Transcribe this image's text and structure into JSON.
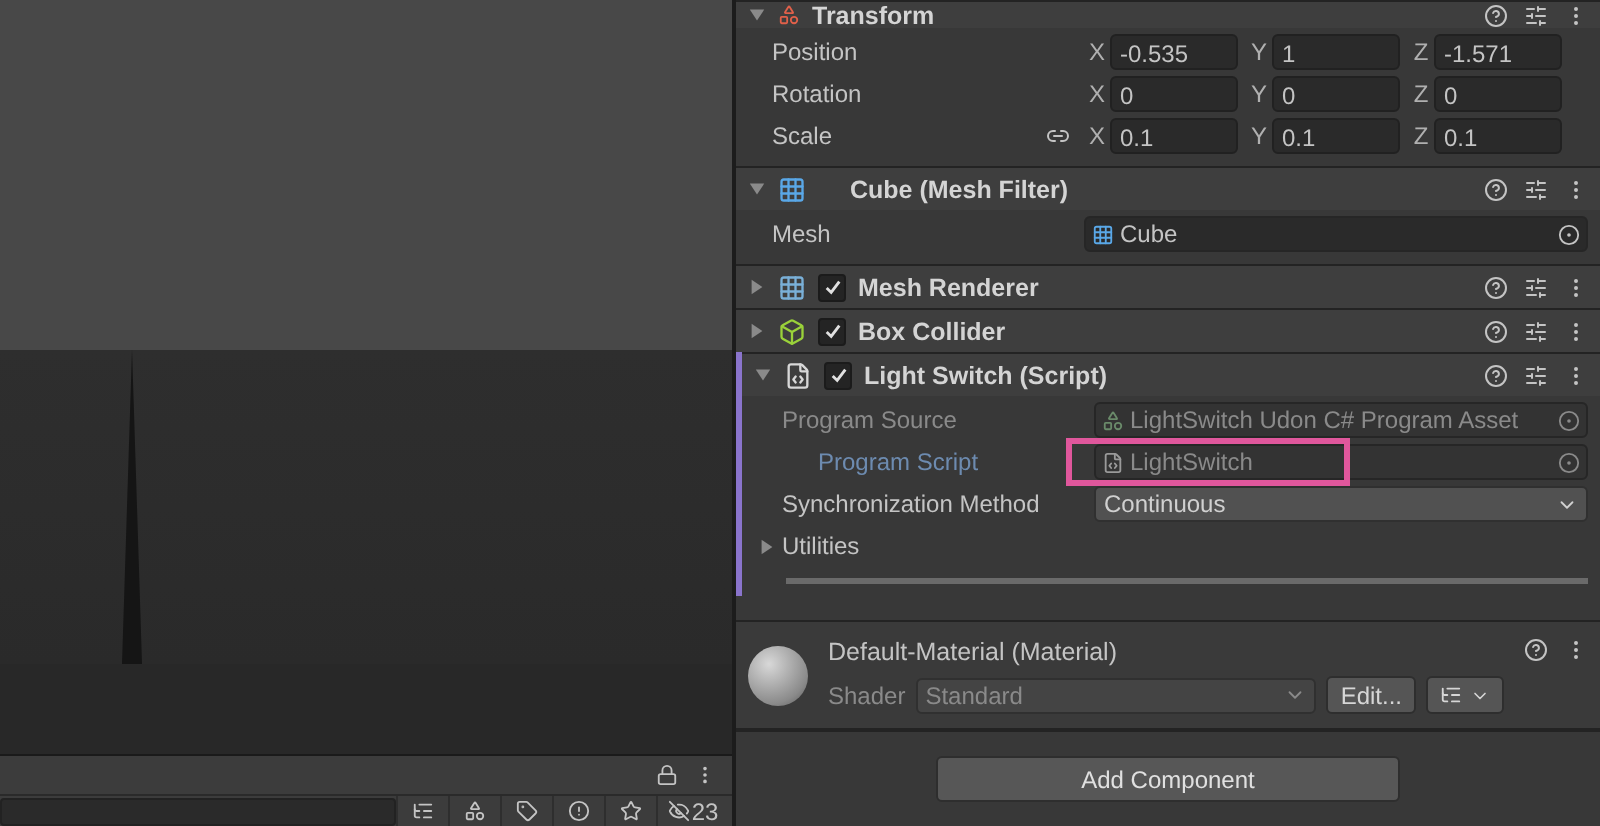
{
  "scene_toolbar": {
    "count": "23"
  },
  "transform": {
    "title": "Transform",
    "expanded": true,
    "rows": [
      {
        "label": "Position",
        "linked": false,
        "values": [
          {
            "axis": "X",
            "value": "-0.535"
          },
          {
            "axis": "Y",
            "value": "1"
          },
          {
            "axis": "Z",
            "value": "-1.571"
          }
        ]
      },
      {
        "label": "Rotation",
        "linked": false,
        "values": [
          {
            "axis": "X",
            "value": "0"
          },
          {
            "axis": "Y",
            "value": "0"
          },
          {
            "axis": "Z",
            "value": "0"
          }
        ]
      },
      {
        "label": "Scale",
        "linked": true,
        "values": [
          {
            "axis": "X",
            "value": "0.1"
          },
          {
            "axis": "Y",
            "value": "0.1"
          },
          {
            "axis": "Z",
            "value": "0.1"
          }
        ]
      }
    ]
  },
  "components": [
    {
      "kind": "mesh-filter",
      "title": "Cube (Mesh Filter)",
      "expanded": true,
      "marked": false,
      "fields": [
        {
          "kind": "mesh-object",
          "label": "Mesh",
          "value": "Cube",
          "disabled": false,
          "indented": false,
          "highlighted": false
        }
      ]
    },
    {
      "kind": "mesh-renderer",
      "title": "Mesh Renderer",
      "expanded": false,
      "enabled": true,
      "marked": false
    },
    {
      "kind": "box-collider",
      "title": "Box Collider",
      "expanded": false,
      "enabled": true,
      "marked": false
    },
    {
      "kind": "script",
      "title": "Light Switch (Script)",
      "expanded": true,
      "enabled": true,
      "marked": true,
      "fields": [
        {
          "kind": "program-object",
          "label": "Program Source",
          "value": "LightSwitch Udon C# Program Asset",
          "disabled": true,
          "indented": false,
          "highlighted": false
        },
        {
          "kind": "script-object",
          "label": "Program Script",
          "value": "LightSwitch",
          "disabled": true,
          "indented": true,
          "highlighted": true
        },
        {
          "kind": "dropdown",
          "label": "Synchronization Method",
          "value": "Continuous",
          "disabled": false,
          "indented": false,
          "highlighted": false
        },
        {
          "kind": "foldout",
          "label": "Utilities",
          "expanded": false
        }
      ]
    }
  ],
  "material": {
    "title": "Default-Material (Material)",
    "shader_label": "Shader",
    "shader": "Standard",
    "edit_button": "Edit..."
  },
  "add_component": "Add Component"
}
